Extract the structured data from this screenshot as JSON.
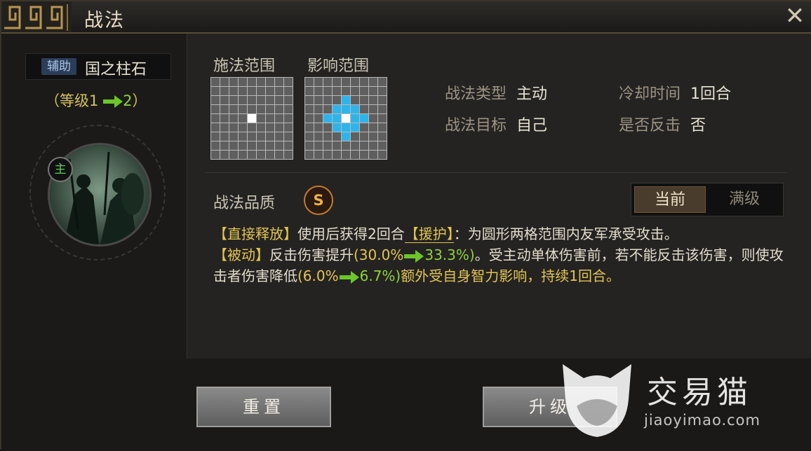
{
  "window": {
    "title": "战法",
    "close_icon": "close-icon"
  },
  "skill": {
    "tag": "辅助",
    "name": "国之柱石",
    "level_open": "（等级",
    "level_from": "1",
    "level_to": "2",
    "level_close": "）",
    "portrait_badge": "主"
  },
  "ranges": {
    "cast_label": "施法范围",
    "effect_label": "影响范围"
  },
  "info": {
    "type_key": "战法类型",
    "type_val": "主动",
    "cooldown_key": "冷却时间",
    "cooldown_val": "1回合",
    "target_key": "战法目标",
    "target_val": "自己",
    "counter_key": "是否反击",
    "counter_val": "否"
  },
  "quality": {
    "label": "战法品质",
    "grade": "S"
  },
  "toggle": {
    "current": "当前",
    "max": "满级"
  },
  "desc": {
    "p1": "【直接释放】",
    "p2": "使用后获得2回合",
    "p3": "【援护】",
    "p4": "：为圆形两格范围内友军承受攻击。",
    "p5": "【被动】",
    "p6": "反击伤害提升",
    "p7a": "(30.0%",
    "p7b": "33.3%)",
    "p8": "。受主动单体伤害前，若不能反击该伤害，则使攻击者伤害降低",
    "p9a": "(6.0%",
    "p9b": "6.7%)",
    "p10": "额外受自身智力影响，持续1回合。"
  },
  "buttons": {
    "reset": "重置",
    "upgrade": "升级"
  },
  "watermark": {
    "brand": "交易猫",
    "url": "jiaoyimao.com"
  },
  "colors": {
    "accent_gold": "#e2c552",
    "green": "#8fd23c",
    "blue_cell": "#2fb4ea"
  }
}
